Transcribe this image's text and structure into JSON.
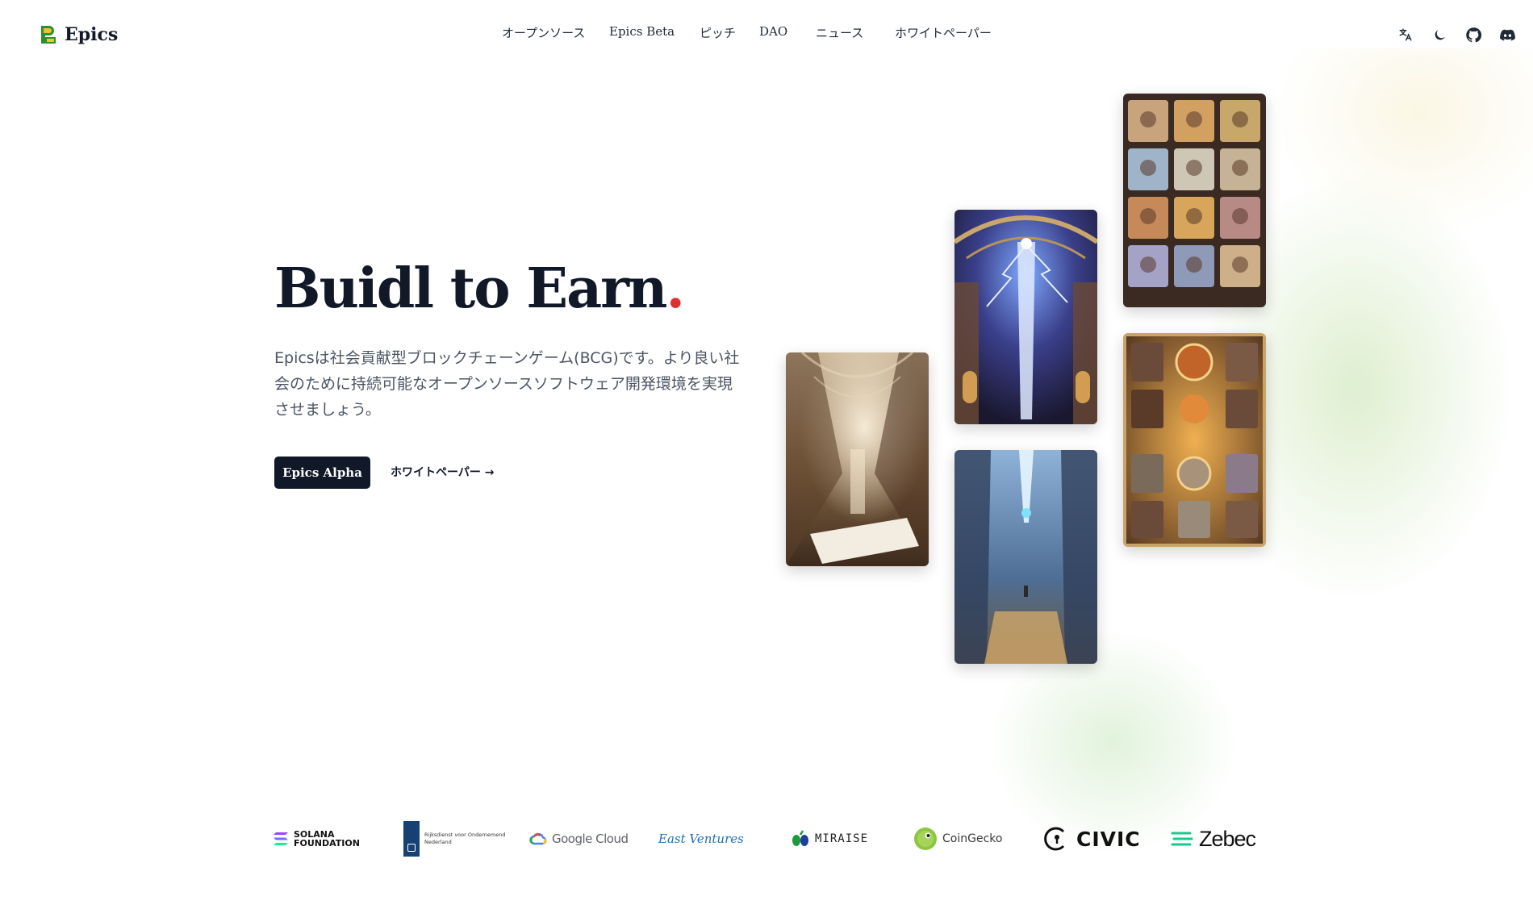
{
  "brand": {
    "name": "Epics",
    "logo_icon": "epics-logo-icon"
  },
  "nav": {
    "items": [
      {
        "label": "オープンソース"
      },
      {
        "label": "Epics Beta"
      },
      {
        "label": "ピッチ"
      },
      {
        "label": "DAO"
      },
      {
        "label": "ニュース"
      },
      {
        "label": "ホワイトペーパー"
      }
    ],
    "icons": [
      "translate-icon",
      "moon-icon",
      "github-icon",
      "discord-icon"
    ]
  },
  "hero": {
    "title": "Buidl to Earn",
    "title_dot": ".",
    "description": "Epicsは社会貢献型ブロックチェーンゲーム(BCG)です。より良い社会のために持続可能なオープンソースソフトウェア開発環境を実現させましょう。",
    "primary_button": "Epics Alpha",
    "secondary_link": "ホワイトペーパー →"
  },
  "gallery": [
    {
      "name": "cathedral-hall-image"
    },
    {
      "name": "lightning-dome-image"
    },
    {
      "name": "blue-beam-gothic-image"
    },
    {
      "name": "card-collection-grid-image"
    },
    {
      "name": "card-battle-board-image"
    }
  ],
  "partners": {
    "solana_line1": "SOLANA",
    "solana_line2": "FOUNDATION",
    "rvo_line1": "Rijksdienst voor Ondernemend",
    "rvo_line2": "Nederland",
    "google": "Google Cloud",
    "east": "East Ventures",
    "miraise": "MIRAISE",
    "coingecko": "CoinGecko",
    "civic": "CIVIC",
    "zebec": "Zebec"
  },
  "colors": {
    "ink": "#111827",
    "accent_dot": "#e03131",
    "body_text": "#4b5563"
  }
}
